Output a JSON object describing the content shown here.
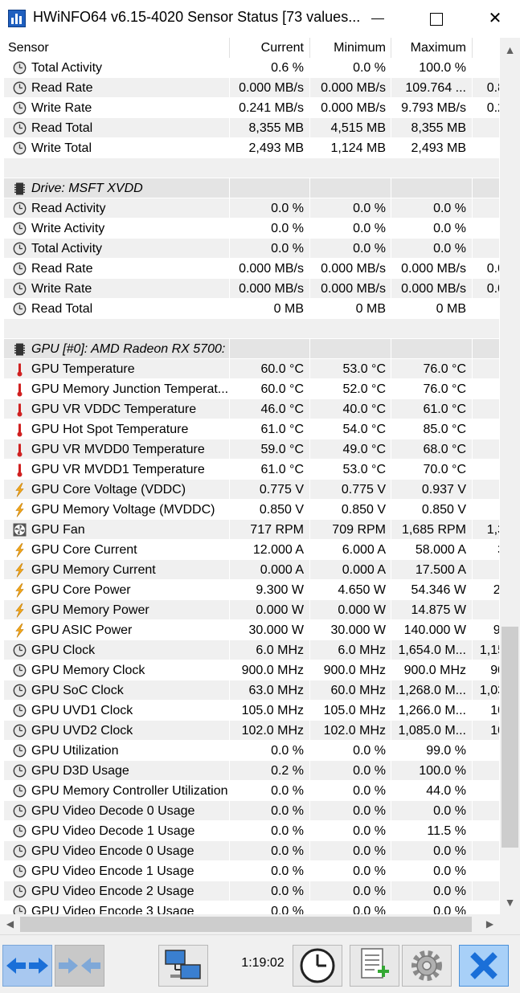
{
  "window": {
    "title": "HWiNFO64 v6.15-4020 Sensor Status [73 values..."
  },
  "columns": {
    "sensor": "Sensor",
    "current": "Current",
    "minimum": "Minimum",
    "maximum": "Maximum"
  },
  "rows": [
    {
      "type": "sensor",
      "icon": "clock-icon",
      "name": "Total Activity",
      "cur": "0.6 %",
      "min": "0.0 %",
      "max": "100.0 %",
      "avg": ""
    },
    {
      "type": "sensor",
      "icon": "clock-icon",
      "name": "Read Rate",
      "cur": "0.000 MB/s",
      "min": "0.000 MB/s",
      "max": "109.764 ...",
      "avg": "0.8"
    },
    {
      "type": "sensor",
      "icon": "clock-icon",
      "name": "Write Rate",
      "cur": "0.241 MB/s",
      "min": "0.000 MB/s",
      "max": "9.793 MB/s",
      "avg": "0.2"
    },
    {
      "type": "sensor",
      "icon": "clock-icon",
      "name": "Read Total",
      "cur": "8,355 MB",
      "min": "4,515 MB",
      "max": "8,355 MB",
      "avg": ""
    },
    {
      "type": "sensor",
      "icon": "clock-icon",
      "name": "Write Total",
      "cur": "2,493 MB",
      "min": "1,124 MB",
      "max": "2,493 MB",
      "avg": ""
    },
    {
      "type": "blank"
    },
    {
      "type": "group",
      "icon": "chip-icon",
      "name": "Drive: MSFT XVDD"
    },
    {
      "type": "sensor",
      "icon": "clock-icon",
      "name": "Read Activity",
      "cur": "0.0 %",
      "min": "0.0 %",
      "max": "0.0 %",
      "avg": ""
    },
    {
      "type": "sensor",
      "icon": "clock-icon",
      "name": "Write Activity",
      "cur": "0.0 %",
      "min": "0.0 %",
      "max": "0.0 %",
      "avg": ""
    },
    {
      "type": "sensor",
      "icon": "clock-icon",
      "name": "Total Activity",
      "cur": "0.0 %",
      "min": "0.0 %",
      "max": "0.0 %",
      "avg": ""
    },
    {
      "type": "sensor",
      "icon": "clock-icon",
      "name": "Read Rate",
      "cur": "0.000 MB/s",
      "min": "0.000 MB/s",
      "max": "0.000 MB/s",
      "avg": "0.0"
    },
    {
      "type": "sensor",
      "icon": "clock-icon",
      "name": "Write Rate",
      "cur": "0.000 MB/s",
      "min": "0.000 MB/s",
      "max": "0.000 MB/s",
      "avg": "0.0"
    },
    {
      "type": "sensor",
      "icon": "clock-icon",
      "name": "Read Total",
      "cur": "0 MB",
      "min": "0 MB",
      "max": "0 MB",
      "avg": ""
    },
    {
      "type": "blank"
    },
    {
      "type": "group",
      "icon": "chip-icon",
      "name": "GPU [#0]: AMD Radeon RX 5700:"
    },
    {
      "type": "sensor",
      "icon": "thermometer-icon",
      "name": "GPU Temperature",
      "cur": "60.0 °C",
      "min": "53.0 °C",
      "max": "76.0 °C",
      "avg": ""
    },
    {
      "type": "sensor",
      "icon": "thermometer-icon",
      "name": "GPU Memory Junction Temperat...",
      "cur": "60.0 °C",
      "min": "52.0 °C",
      "max": "76.0 °C",
      "avg": ""
    },
    {
      "type": "sensor",
      "icon": "thermometer-icon",
      "name": "GPU VR VDDC Temperature",
      "cur": "46.0 °C",
      "min": "40.0 °C",
      "max": "61.0 °C",
      "avg": ""
    },
    {
      "type": "sensor",
      "icon": "thermometer-icon",
      "name": "GPU Hot Spot Temperature",
      "cur": "61.0 °C",
      "min": "54.0 °C",
      "max": "85.0 °C",
      "avg": ""
    },
    {
      "type": "sensor",
      "icon": "thermometer-icon",
      "name": "GPU VR MVDD0 Temperature",
      "cur": "59.0 °C",
      "min": "49.0 °C",
      "max": "68.0 °C",
      "avg": ""
    },
    {
      "type": "sensor",
      "icon": "thermometer-icon",
      "name": "GPU VR MVDD1 Temperature",
      "cur": "61.0 °C",
      "min": "53.0 °C",
      "max": "70.0 °C",
      "avg": ""
    },
    {
      "type": "sensor",
      "icon": "lightning-icon",
      "name": "GPU Core Voltage (VDDC)",
      "cur": "0.775 V",
      "min": "0.775 V",
      "max": "0.937 V",
      "avg": ""
    },
    {
      "type": "sensor",
      "icon": "lightning-icon",
      "name": "GPU Memory Voltage (MVDDC)",
      "cur": "0.850 V",
      "min": "0.850 V",
      "max": "0.850 V",
      "avg": ""
    },
    {
      "type": "sensor",
      "icon": "fan-icon",
      "name": "GPU Fan",
      "cur": "717 RPM",
      "min": "709 RPM",
      "max": "1,685 RPM",
      "avg": "1,3"
    },
    {
      "type": "sensor",
      "icon": "lightning-icon",
      "name": "GPU Core Current",
      "cur": "12.000 A",
      "min": "6.000 A",
      "max": "58.000 A",
      "avg": "3"
    },
    {
      "type": "sensor",
      "icon": "lightning-icon",
      "name": "GPU Memory Current",
      "cur": "0.000 A",
      "min": "0.000 A",
      "max": "17.500 A",
      "avg": ""
    },
    {
      "type": "sensor",
      "icon": "lightning-icon",
      "name": "GPU Core Power",
      "cur": "9.300 W",
      "min": "4.650 W",
      "max": "54.346 W",
      "avg": "2("
    },
    {
      "type": "sensor",
      "icon": "lightning-icon",
      "name": "GPU Memory Power",
      "cur": "0.000 W",
      "min": "0.000 W",
      "max": "14.875 W",
      "avg": "("
    },
    {
      "type": "sensor",
      "icon": "lightning-icon",
      "name": "GPU ASIC Power",
      "cur": "30.000 W",
      "min": "30.000 W",
      "max": "140.000 W",
      "avg": "9("
    },
    {
      "type": "sensor",
      "icon": "clock-icon",
      "name": "GPU Clock",
      "cur": "6.0 MHz",
      "min": "6.0 MHz",
      "max": "1,654.0 M...",
      "avg": "1,15"
    },
    {
      "type": "sensor",
      "icon": "clock-icon",
      "name": "GPU Memory Clock",
      "cur": "900.0 MHz",
      "min": "900.0 MHz",
      "max": "900.0 MHz",
      "avg": "90"
    },
    {
      "type": "sensor",
      "icon": "clock-icon",
      "name": "GPU SoC Clock",
      "cur": "63.0 MHz",
      "min": "60.0 MHz",
      "max": "1,268.0 M...",
      "avg": "1,03"
    },
    {
      "type": "sensor",
      "icon": "clock-icon",
      "name": "GPU UVD1 Clock",
      "cur": "105.0 MHz",
      "min": "105.0 MHz",
      "max": "1,266.0 M...",
      "avg": "10"
    },
    {
      "type": "sensor",
      "icon": "clock-icon",
      "name": "GPU UVD2 Clock",
      "cur": "102.0 MHz",
      "min": "102.0 MHz",
      "max": "1,085.0 M...",
      "avg": "10"
    },
    {
      "type": "sensor",
      "icon": "clock-icon",
      "name": "GPU Utilization",
      "cur": "0.0 %",
      "min": "0.0 %",
      "max": "99.0 %",
      "avg": ""
    },
    {
      "type": "sensor",
      "icon": "clock-icon",
      "name": "GPU D3D Usage",
      "cur": "0.2 %",
      "min": "0.0 %",
      "max": "100.0 %",
      "avg": ""
    },
    {
      "type": "sensor",
      "icon": "clock-icon",
      "name": "GPU Memory Controller Utilization",
      "cur": "0.0 %",
      "min": "0.0 %",
      "max": "44.0 %",
      "avg": ""
    },
    {
      "type": "sensor",
      "icon": "clock-icon",
      "name": "GPU Video Decode 0 Usage",
      "cur": "0.0 %",
      "min": "0.0 %",
      "max": "0.0 %",
      "avg": ""
    },
    {
      "type": "sensor",
      "icon": "clock-icon",
      "name": "GPU Video Decode 1 Usage",
      "cur": "0.0 %",
      "min": "0.0 %",
      "max": "11.5 %",
      "avg": ""
    },
    {
      "type": "sensor",
      "icon": "clock-icon",
      "name": "GPU Video Encode 0 Usage",
      "cur": "0.0 %",
      "min": "0.0 %",
      "max": "0.0 %",
      "avg": ""
    },
    {
      "type": "sensor",
      "icon": "clock-icon",
      "name": "GPU Video Encode 1 Usage",
      "cur": "0.0 %",
      "min": "0.0 %",
      "max": "0.0 %",
      "avg": ""
    },
    {
      "type": "sensor",
      "icon": "clock-icon",
      "name": "GPU Video Encode 2 Usage",
      "cur": "0.0 %",
      "min": "0.0 %",
      "max": "0.0 %",
      "avg": ""
    },
    {
      "type": "sensor",
      "icon": "clock-icon",
      "name": "GPU Video Encode 3 Usage",
      "cur": "0.0 %",
      "min": "0.0 %",
      "max": "0.0 %",
      "avg": ""
    }
  ],
  "toolbar": {
    "timer": "1:19:02",
    "buttons": [
      {
        "name": "nav-left-right-button",
        "icon": "arrows-icon"
      },
      {
        "name": "nav-collapse-button",
        "icon": "arrows-in-icon"
      },
      {
        "name": "network-button",
        "icon": "network-icon"
      },
      {
        "name": "clock-button",
        "icon": "clock-icon"
      },
      {
        "name": "report-button",
        "icon": "report-add-icon"
      },
      {
        "name": "settings-button",
        "icon": "gear-icon"
      },
      {
        "name": "close-sensors-button",
        "icon": "close-icon"
      }
    ]
  },
  "colors": {
    "accent": "#1f5fbf",
    "thermo": "#d02020",
    "lightning": "#f2a81d",
    "row_alt": "#f0f0f0",
    "group_row": "#e4e4e4"
  }
}
